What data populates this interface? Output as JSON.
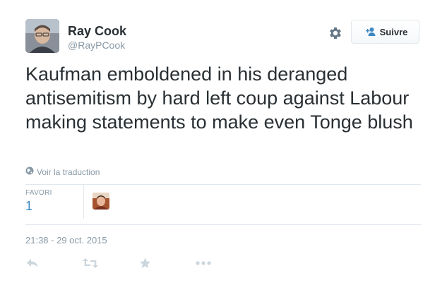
{
  "user": {
    "name": "Ray Cook",
    "handle": "@RayPCook"
  },
  "follow_button": {
    "label": "Suivre"
  },
  "tweet": {
    "text": "Kaufman emboldened in his deranged antisemitism by hard left coup against Labour making statements to make even Tonge blush",
    "translate_label": "Voir la traduction",
    "favorites_label": "FAVORI",
    "favorites_count": "1",
    "timestamp": "21:38 - 29 oct. 2015"
  },
  "icons": {
    "settings": "gear-icon",
    "follow": "add-user-icon",
    "translate": "globe-icon",
    "reply": "reply-icon",
    "retweet": "retweet-icon",
    "favorite": "star-icon",
    "more": "more-icon"
  },
  "colors": {
    "link": "#3b88c3",
    "muted": "#8899a6",
    "action_icon": "#ccd6dd",
    "text": "#292f33"
  }
}
